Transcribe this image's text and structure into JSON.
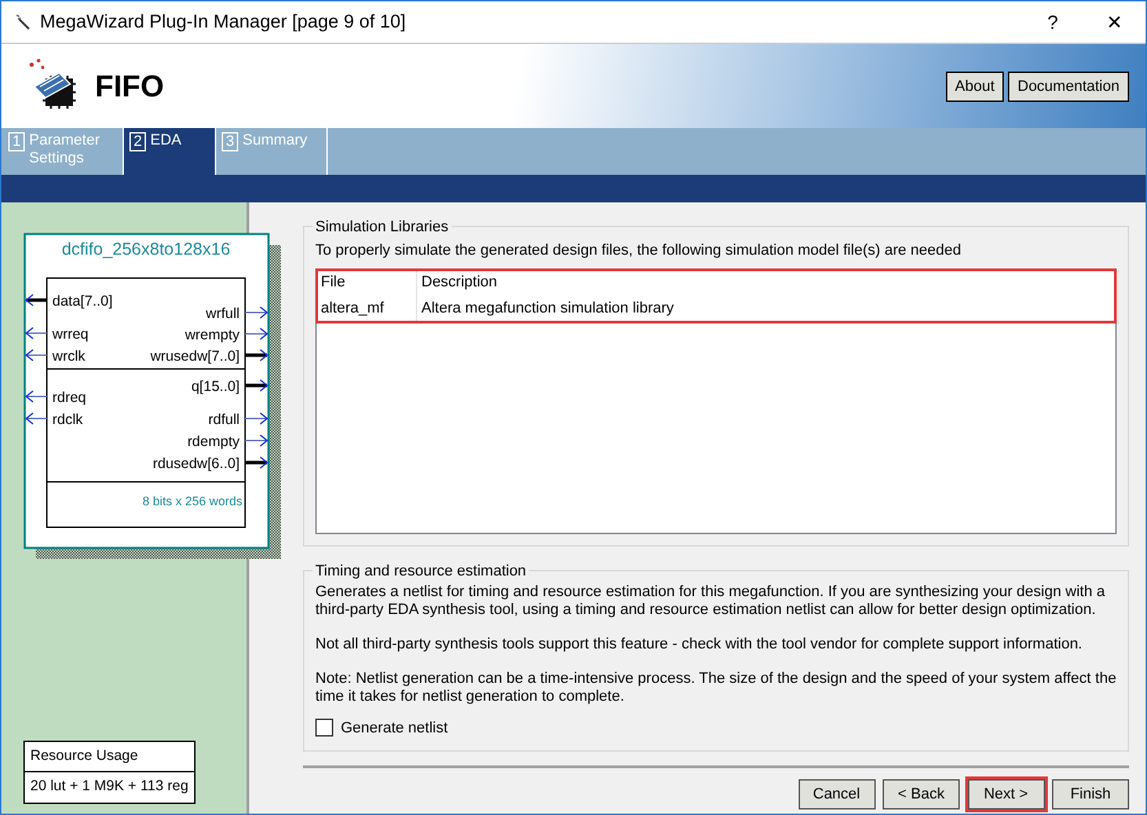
{
  "window": {
    "title": "MegaWizard Plug-In Manager [page 9 of 10]",
    "controls": [
      "?",
      "✕"
    ]
  },
  "header": {
    "title": "FIFO",
    "buttons": [
      "About",
      "Documentation"
    ]
  },
  "tabs": [
    {
      "number": "1",
      "label": "Parameter Settings",
      "selected": false
    },
    {
      "number": "2",
      "label": "EDA",
      "selected": true
    },
    {
      "number": "3",
      "label": "Summary",
      "selected": false
    }
  ],
  "symbol": {
    "title": "dcfifo_256x8to128x16",
    "sections": [
      {
        "inputs": [
          {
            "label": "data[7..0]",
            "bus": true
          },
          {
            "label": "wrreq",
            "bus": false
          },
          {
            "label": "wrclk",
            "bus": false
          }
        ],
        "outputs": [
          {
            "label": "wrfull",
            "bus": false
          },
          {
            "label": "wrempty",
            "bus": false
          },
          {
            "label": "wrusedw[7..0]",
            "bus": true
          }
        ]
      },
      {
        "inputs": [
          {
            "label": "rdreq",
            "bus": false
          },
          {
            "label": "rdclk",
            "bus": false
          }
        ],
        "outputs": [
          {
            "label": "q[15..0]",
            "bus": true
          },
          {
            "label": "rdfull",
            "bus": false
          },
          {
            "label": "rdempty",
            "bus": false
          },
          {
            "label": "rdusedw[6..0]",
            "bus": true
          }
        ]
      }
    ],
    "note": "8 bits x 256 words"
  },
  "resource_usage": {
    "title": "Resource Usage",
    "value": "20 lut + 1 M9K + 113 reg"
  },
  "simulation_libraries": {
    "legend": "Simulation Libraries",
    "description": "To properly simulate the generated design files, the following simulation model file(s) are needed",
    "highlighted": true,
    "columns": [
      "File",
      "Description"
    ],
    "rows": [
      [
        "altera_mf",
        "Altera megafunction simulation library"
      ]
    ]
  },
  "timing": {
    "legend": "Timing and resource estimation",
    "paragraphs": [
      "Generates a netlist for timing and resource estimation for this megafunction. If you are synthesizing your design with a third-party EDA synthesis tool, using a timing and resource estimation netlist can allow for better design optimization.",
      "Not all third-party synthesis tools support this feature - check with the tool vendor for complete support information.",
      "Note: Netlist generation can be a time-intensive process. The size of the design and the speed of your system affect the time it takes for netlist generation to complete."
    ],
    "checkbox": {
      "label": "Generate netlist",
      "checked": false
    }
  },
  "buttons": [
    {
      "label": "Cancel",
      "highlighted": false
    },
    {
      "label": "< Back",
      "highlighted": false
    },
    {
      "label": "Next >",
      "highlighted": true
    },
    {
      "label": "Finish",
      "highlighted": false
    }
  ]
}
